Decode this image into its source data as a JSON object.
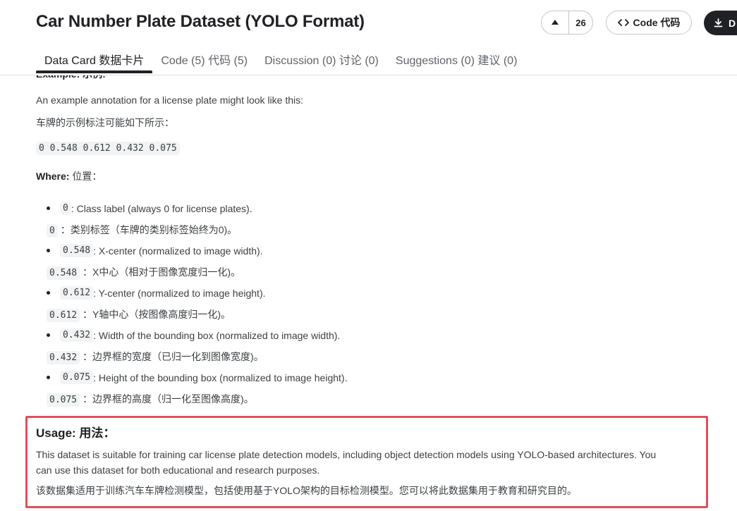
{
  "header": {
    "title": "Car Number Plate Dataset (YOLO Format)",
    "upvote_count": "26",
    "code_button": "Code 代码",
    "download_button": "D"
  },
  "tabs": [
    {
      "label": "Data Card 数据卡片",
      "active": true
    },
    {
      "label": "Code (5) 代码 (5)",
      "active": false
    },
    {
      "label": "Discussion (0) 讨论 (0)",
      "active": false
    },
    {
      "label": "Suggestions (0) 建议 (0)",
      "active": false
    }
  ],
  "content": {
    "example_heading_cut": "Example: 示例:",
    "example_intro": "An example annotation for a license plate might look like this:",
    "example_intro_zh": "车牌的示例标注可能如下所示：",
    "example_code": "0 0.548 0.612 0.432 0.075",
    "where_label": "Where:",
    "where_label_zh": "位置：",
    "items": [
      {
        "code": "0",
        "text": ": Class label (always 0 for license plates).",
        "zh": "：类别标签（车牌的类别标签始终为0)。"
      },
      {
        "code": "0.548",
        "text": ": X-center (normalized to image width).",
        "zh": "：X中心（相对于图像宽度归一化)。"
      },
      {
        "code": "0.612",
        "text": ": Y-center (normalized to image height).",
        "zh": "：Y轴中心（按图像高度归一化)。"
      },
      {
        "code": "0.432",
        "text": ": Width of the bounding box (normalized to image width).",
        "zh": "：边界框的宽度（已归一化到图像宽度)。"
      },
      {
        "code": "0.075",
        "text": ": Height of the bounding box (normalized to image height).",
        "zh": "：边界框的高度（归一化至图像高度)。"
      }
    ],
    "usage_title": "Usage: 用法：",
    "usage_text_1": "This dataset is suitable for training car license plate detection models, including object detection models using YOLO-based architectures. You",
    "usage_text_2": "can use this dataset for both educational and research purposes.",
    "usage_text_zh": "该数据集适用于训练汽车车牌检测模型，包括使用基于YOLO架构的目标检测模型。您可以将此数据集用于教育和研究目的。",
    "highlight_color": "#e0505a"
  }
}
